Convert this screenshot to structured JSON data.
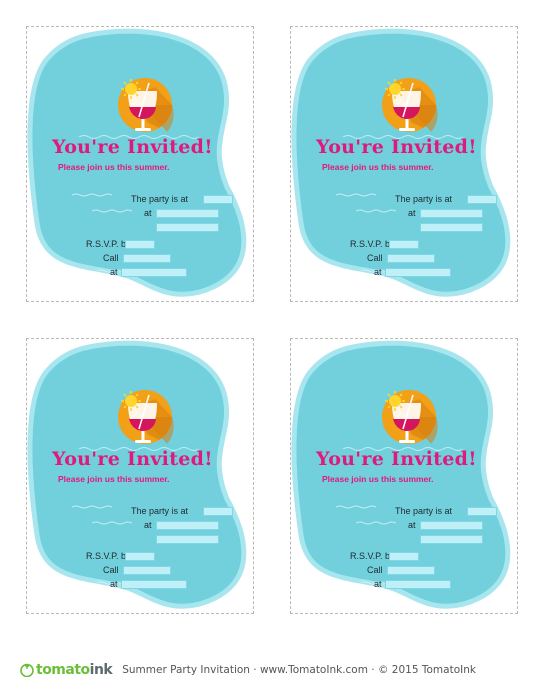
{
  "invitation": {
    "title": "You're Invited!",
    "subtitle": "Please join us this summer.",
    "labels": {
      "party": "The party is at",
      "at": "at",
      "rsvp": "R.S.V.P. by",
      "call": "Call",
      "at2": "at"
    }
  },
  "footer": {
    "logo_tomato": "tomato",
    "logo_ink": "ink",
    "text": "Summer Party Invitation · www.TomatoInk.com · © 2015 TomatoInk"
  },
  "colors": {
    "pool": "#72cfdc",
    "pool_border": "#a8e6ef",
    "circle": "#f2a018",
    "accent": "#e0197d",
    "sun": "#ffd42b"
  }
}
